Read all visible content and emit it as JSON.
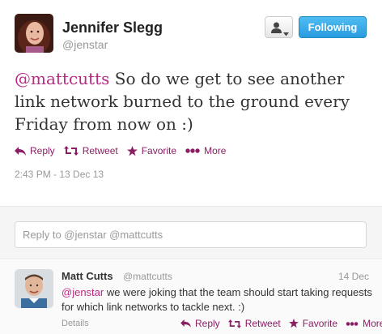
{
  "main_tweet": {
    "fullname": "Jennifer Slegg",
    "username": "@jenstar",
    "follow_label": "Following",
    "text_mention": "@mattcutts",
    "text_body": " So do we get to see another link network burned to the ground every Friday from now on :)",
    "actions": {
      "reply": "Reply",
      "retweet": "Retweet",
      "favorite": "Favorite",
      "more": "More"
    },
    "timestamp": "2:43 PM - 13 Dec 13"
  },
  "reply_box": {
    "placeholder": "Reply to @jenstar @mattcutts"
  },
  "reply_tweet": {
    "fullname": "Matt Cutts",
    "username": "@mattcutts",
    "date": "14 Dec",
    "text_mention": "@jenstar",
    "text_body": " we were joking that the team should start taking requests for which link networks to tackle next. :)",
    "details_label": "Details",
    "actions": {
      "reply": "Reply",
      "retweet": "Retweet",
      "favorite": "Favorite",
      "more": "More"
    }
  },
  "colors": {
    "accent": "#8a1e63",
    "mention": "#bd2a85",
    "follow_button": "#2a9be0"
  }
}
